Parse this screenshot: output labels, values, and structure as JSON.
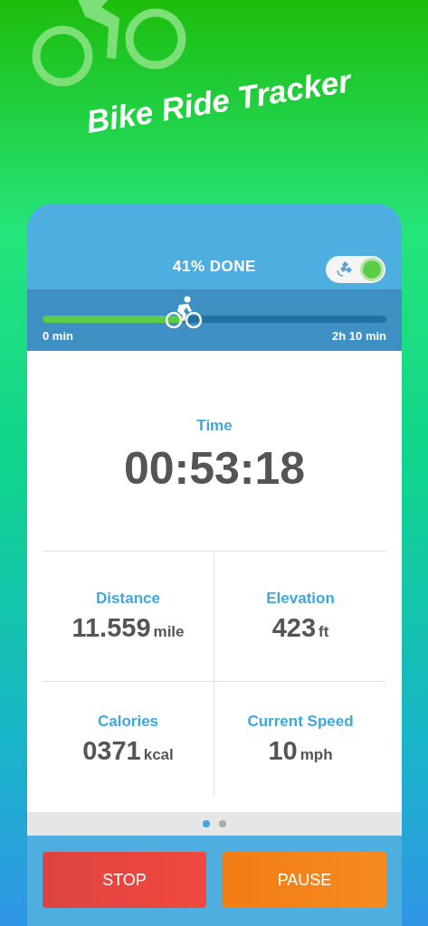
{
  "app_title": "Bike Ride Tracker",
  "progress": {
    "label": "41% DONE",
    "level": 0.41,
    "start_label": "0 min",
    "end_label": "2h 10 min"
  },
  "gps_toggle": {
    "on": true
  },
  "time": {
    "label": "Time",
    "value": "00:53:18"
  },
  "stats": [
    {
      "label": "Distance",
      "value": "11.559",
      "unit": "mile"
    },
    {
      "label": "Elevation",
      "value": "423",
      "unit": "ft"
    },
    {
      "label": "Calories",
      "value": "0371",
      "unit": "kcal"
    },
    {
      "label": "Current Speed",
      "value": "10",
      "unit": "mph"
    }
  ],
  "pages": [
    {
      "selected": true
    },
    {
      "selected": false
    }
  ],
  "buttons": [
    {
      "label": "STOP",
      "kind": "stop"
    },
    {
      "label": "PAUSE",
      "kind": "pause"
    }
  ]
}
